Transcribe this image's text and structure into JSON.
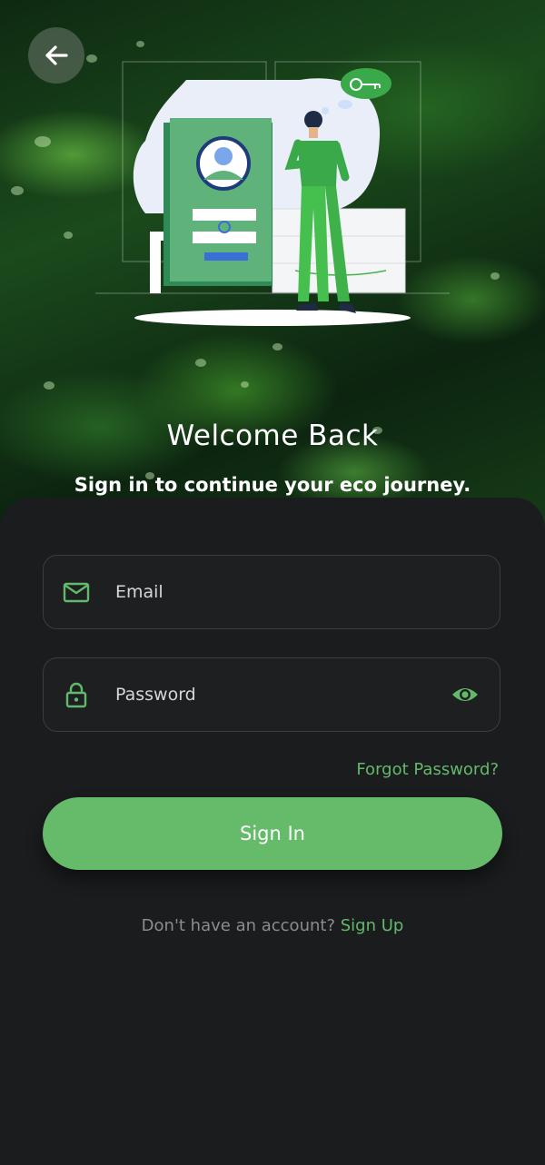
{
  "header": {
    "back_icon": "arrow-left-icon",
    "title": "Welcome Back",
    "subtitle": "Sign in to continue your eco journey."
  },
  "illustration": {
    "icon": "key-icon"
  },
  "form": {
    "email": {
      "placeholder": "Email",
      "icon": "mail-icon"
    },
    "password": {
      "placeholder": "Password",
      "icon": "lock-icon",
      "toggle_icon": "eye-icon"
    },
    "forgot_label": "Forgot Password?",
    "submit_label": "Sign In"
  },
  "footer": {
    "prompt": "Don't have an account?",
    "link": "Sign Up"
  },
  "colors": {
    "accent": "#66bb6a",
    "accent_text": "#63b96b",
    "card_bg": "#1b1c1e",
    "field_border": "#3a3d41"
  }
}
